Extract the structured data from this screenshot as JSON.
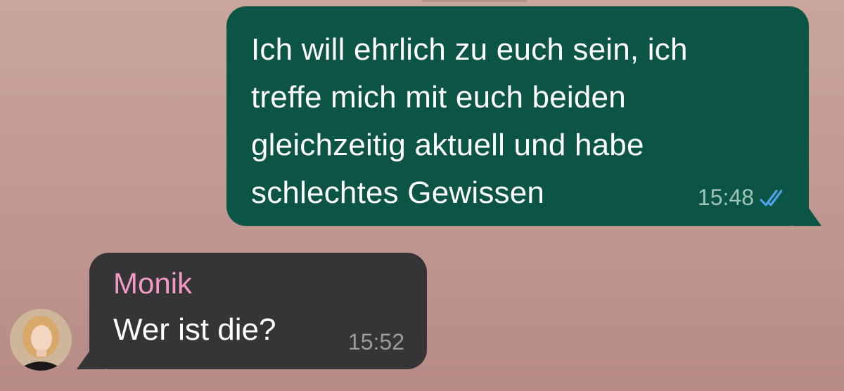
{
  "conversation": {
    "messages": [
      {
        "direction": "outgoing",
        "text": "Ich will ehrlich zu euch sein, ich\ntreffe mich mit euch beiden\ngleichzeitig aktuell und habe\nschlechtes Gewissen",
        "time": "15:48",
        "status_icon": "double-check-icon",
        "status_color": "#4da3e8",
        "bubble_color": "#0b5446"
      },
      {
        "direction": "incoming",
        "sender": "Monik",
        "sender_color": "#f29ac6",
        "text": "Wer ist die?",
        "time": "15:52",
        "avatar_icon": "avatar",
        "bubble_color": "#353537"
      }
    ]
  }
}
